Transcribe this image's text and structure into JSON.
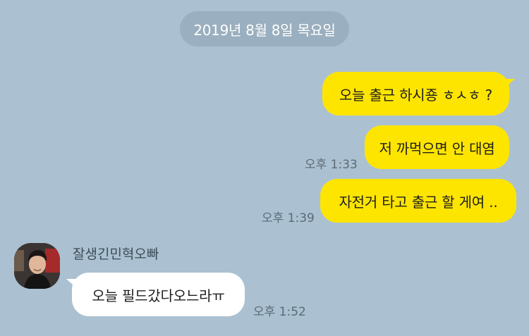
{
  "date_divider": "2019년 8월 8일 목요일",
  "messages": [
    {
      "text": "오늘 출근 하시죵 ㅎㅅㅎ ?",
      "time": ""
    },
    {
      "text": "저 까먹으면 안 대염",
      "time": "오후 1:33"
    },
    {
      "text": "자전거 타고 출근 할 게여 ..",
      "time": "오후 1:39"
    }
  ],
  "incoming": {
    "sender": "잘생긴민혁오빠",
    "text": "오늘 필드갔다오느라ㅠ",
    "time": "오후 1:52"
  },
  "colors": {
    "background": "#abc1d1",
    "my_bubble": "#fee500",
    "their_bubble": "#ffffff",
    "date_pill": "#9aafbf"
  }
}
